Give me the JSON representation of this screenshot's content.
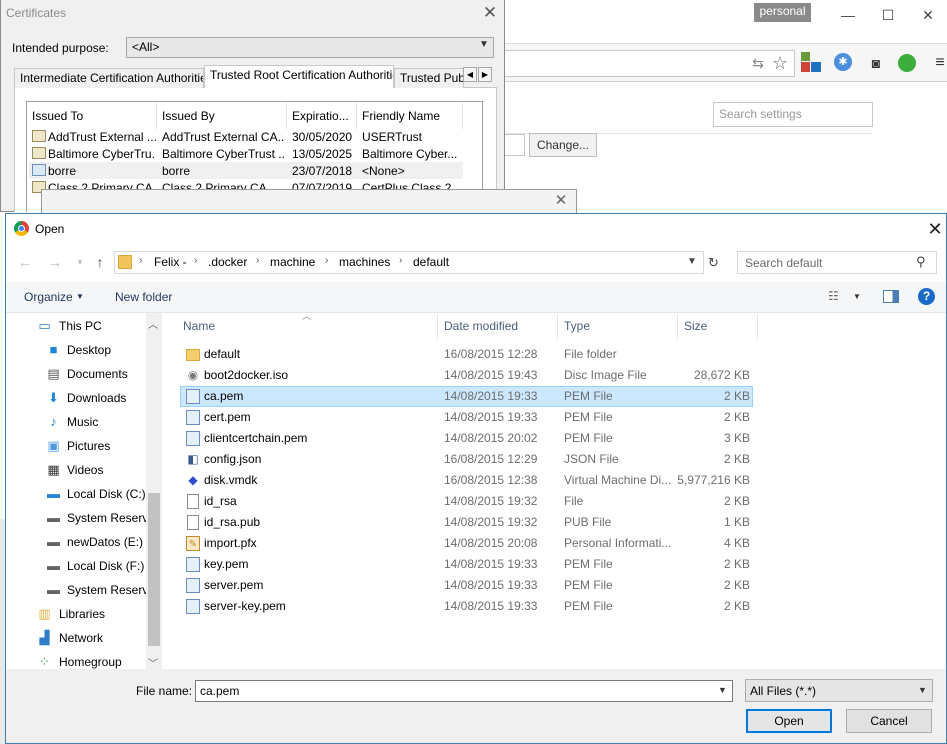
{
  "browser": {
    "profile": "personal",
    "controls": {
      "minimize": "—",
      "maximize": "☐",
      "close": "✕"
    },
    "settings_search_placeholder": "Search settings",
    "change_button": "Change...",
    "ext_icons": [
      "translate-icon",
      "bookmark-star-icon",
      "color-blocks-icon",
      "sync-icon",
      "incognito-icon",
      "evernote-icon",
      "menu-icon"
    ]
  },
  "certificates": {
    "title": "Certificates",
    "intended_purpose_label": "Intended purpose:",
    "intended_purpose_value": "<All>",
    "tabs": [
      "Intermediate Certification Authorities",
      "Trusted Root Certification Authorities",
      "Trusted Publ"
    ],
    "columns": [
      "Issued To",
      "Issued By",
      "Expiratio...",
      "Friendly Name"
    ],
    "rows": [
      {
        "issued_to": "AddTrust External ...",
        "issued_by": "AddTrust External CA...",
        "expiration": "30/05/2020",
        "friendly": "USERTrust"
      },
      {
        "issued_to": "Baltimore CyberTru...",
        "issued_by": "Baltimore CyberTrust ...",
        "expiration": "13/05/2025",
        "friendly": "Baltimore Cyber..."
      },
      {
        "issued_to": "borre",
        "issued_by": "borre",
        "expiration": "23/07/2018",
        "friendly": "<None>"
      },
      {
        "issued_to": "Class 2 Primary CA",
        "issued_by": "Class 2 Primary CA",
        "expiration": "07/07/2019",
        "friendly": "CertPlus Class 2..."
      }
    ]
  },
  "open_dialog": {
    "title": "Open",
    "breadcrumbs": [
      "Felix -",
      ".docker",
      "machine",
      "machines",
      "default"
    ],
    "search_placeholder": "Search default",
    "organize": "Organize",
    "new_folder": "New folder",
    "nav_items": [
      {
        "label": "This PC",
        "icon": "pc-icon"
      },
      {
        "label": "Desktop",
        "icon": "desktop-icon"
      },
      {
        "label": "Documents",
        "icon": "documents-icon"
      },
      {
        "label": "Downloads",
        "icon": "downloads-icon"
      },
      {
        "label": "Music",
        "icon": "music-icon"
      },
      {
        "label": "Pictures",
        "icon": "pictures-icon"
      },
      {
        "label": "Videos",
        "icon": "videos-icon"
      },
      {
        "label": "Local Disk (C:)",
        "icon": "drive-icon"
      },
      {
        "label": "System Reserve",
        "icon": "drive-icon"
      },
      {
        "label": "newDatos (E:)",
        "icon": "drive-icon"
      },
      {
        "label": "Local Disk (F:)",
        "icon": "drive-icon"
      },
      {
        "label": "System Reserve",
        "icon": "drive-icon"
      },
      {
        "label": "Libraries",
        "icon": "libraries-icon"
      },
      {
        "label": "Network",
        "icon": "network-icon"
      },
      {
        "label": "Homegroup",
        "icon": "homegroup-icon"
      }
    ],
    "columns": {
      "name": "Name",
      "date": "Date modified",
      "type": "Type",
      "size": "Size"
    },
    "files": [
      {
        "name": "default",
        "date": "16/08/2015 12:28",
        "type": "File folder",
        "size": "",
        "icon": "folder-icon"
      },
      {
        "name": "boot2docker.iso",
        "date": "14/08/2015 19:43",
        "type": "Disc Image File",
        "size": "28,672 KB",
        "icon": "disc-image-icon"
      },
      {
        "name": "ca.pem",
        "date": "14/08/2015 19:33",
        "type": "PEM File",
        "size": "2 KB",
        "icon": "certificate-file-icon"
      },
      {
        "name": "cert.pem",
        "date": "14/08/2015 19:33",
        "type": "PEM File",
        "size": "2 KB",
        "icon": "certificate-file-icon"
      },
      {
        "name": "clientcertchain.pem",
        "date": "14/08/2015 20:02",
        "type": "PEM File",
        "size": "3 KB",
        "icon": "certificate-file-icon"
      },
      {
        "name": "config.json",
        "date": "16/08/2015 12:29",
        "type": "JSON File",
        "size": "2 KB",
        "icon": "json-file-icon"
      },
      {
        "name": "disk.vmdk",
        "date": "16/08/2015 12:38",
        "type": "Virtual Machine Di...",
        "size": "5,977,216 KB",
        "icon": "vmdk-file-icon"
      },
      {
        "name": "id_rsa",
        "date": "14/08/2015 19:32",
        "type": "File",
        "size": "2 KB",
        "icon": "blank-file-icon"
      },
      {
        "name": "id_rsa.pub",
        "date": "14/08/2015 19:32",
        "type": "PUB File",
        "size": "1 KB",
        "icon": "blank-file-icon"
      },
      {
        "name": "import.pfx",
        "date": "14/08/2015 20:08",
        "type": "Personal Informati...",
        "size": "4 KB",
        "icon": "pfx-file-icon"
      },
      {
        "name": "key.pem",
        "date": "14/08/2015 19:33",
        "type": "PEM File",
        "size": "2 KB",
        "icon": "certificate-file-icon"
      },
      {
        "name": "server.pem",
        "date": "14/08/2015 19:33",
        "type": "PEM File",
        "size": "2 KB",
        "icon": "certificate-file-icon"
      },
      {
        "name": "server-key.pem",
        "date": "14/08/2015 19:33",
        "type": "PEM File",
        "size": "2 KB",
        "icon": "certificate-file-icon"
      }
    ],
    "selected_index": 2,
    "file_name_label": "File name:",
    "file_name_value": "ca.pem",
    "filter": "All Files (*.*)",
    "open_button": "Open",
    "cancel_button": "Cancel"
  }
}
